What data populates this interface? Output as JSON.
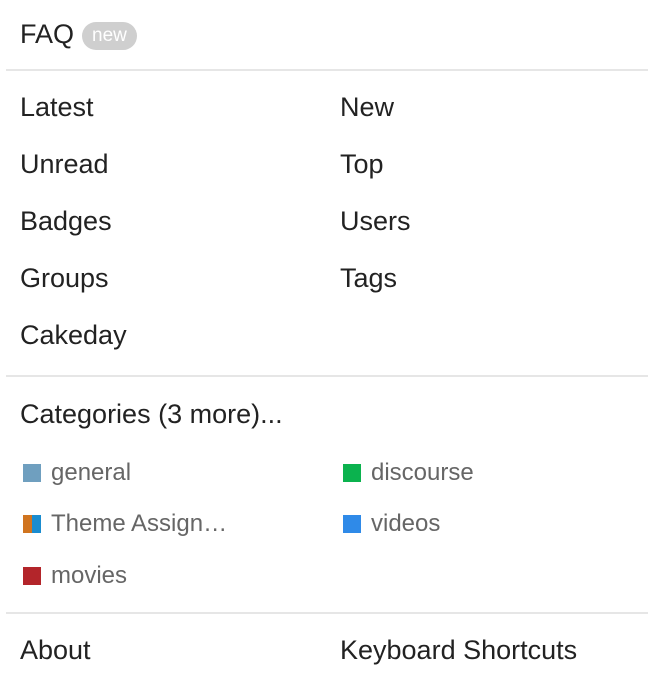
{
  "faq": {
    "label": "FAQ",
    "badge": "new"
  },
  "nav": {
    "items": [
      {
        "label": "Latest"
      },
      {
        "label": "New"
      },
      {
        "label": "Unread"
      },
      {
        "label": "Top"
      },
      {
        "label": "Badges"
      },
      {
        "label": "Users"
      },
      {
        "label": "Groups"
      },
      {
        "label": "Tags"
      },
      {
        "label": "Cakeday"
      }
    ]
  },
  "categories": {
    "heading": "Categories (3 more)...",
    "items": [
      {
        "label": "general",
        "color": "#6f9fbf"
      },
      {
        "label": "discourse",
        "color": "#0bb24e"
      },
      {
        "label": "Theme Assign…",
        "color": "#d0741f",
        "color2": "#1a8ccf"
      },
      {
        "label": "videos",
        "color": "#2f8ae8"
      },
      {
        "label": "movies",
        "color": "#b3252a"
      }
    ]
  },
  "footer": {
    "about": "About",
    "keyboard_shortcuts": "Keyboard Shortcuts"
  }
}
